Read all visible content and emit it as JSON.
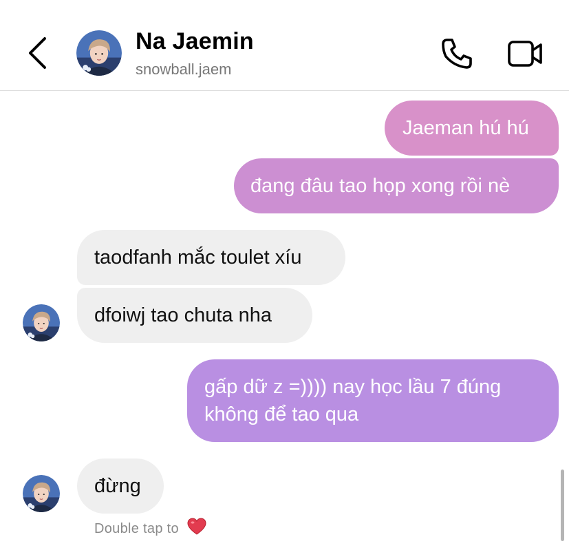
{
  "header": {
    "name": "Na Jaemin",
    "username": "snowball.jaem",
    "back_icon": "chevron-left-icon",
    "call_icon": "phone-icon",
    "video_icon": "video-camera-icon"
  },
  "messages": [
    {
      "direction": "out",
      "text": "Jaeman hú hú"
    },
    {
      "direction": "out",
      "text": "đang đâu tao họp xong rồi nè"
    },
    {
      "direction": "in",
      "text": "taodfanh mắc toulet xíu"
    },
    {
      "direction": "in",
      "text": "dfoiwj tao chuta nha"
    },
    {
      "direction": "out",
      "lines": [
        "gấp dữ z =)))) nay học lầu 7 đúng",
        "không để tao qua"
      ]
    },
    {
      "direction": "in",
      "text": "đừng"
    }
  ],
  "hint": {
    "text": "Double tap to",
    "icon": "heart-icon"
  },
  "colors": {
    "outgoing_1": "#d891c9",
    "outgoing_2": "#cc8fd2",
    "outgoing_3": "#b98fe2",
    "incoming": "#efefef",
    "heart": "#e0245e"
  }
}
